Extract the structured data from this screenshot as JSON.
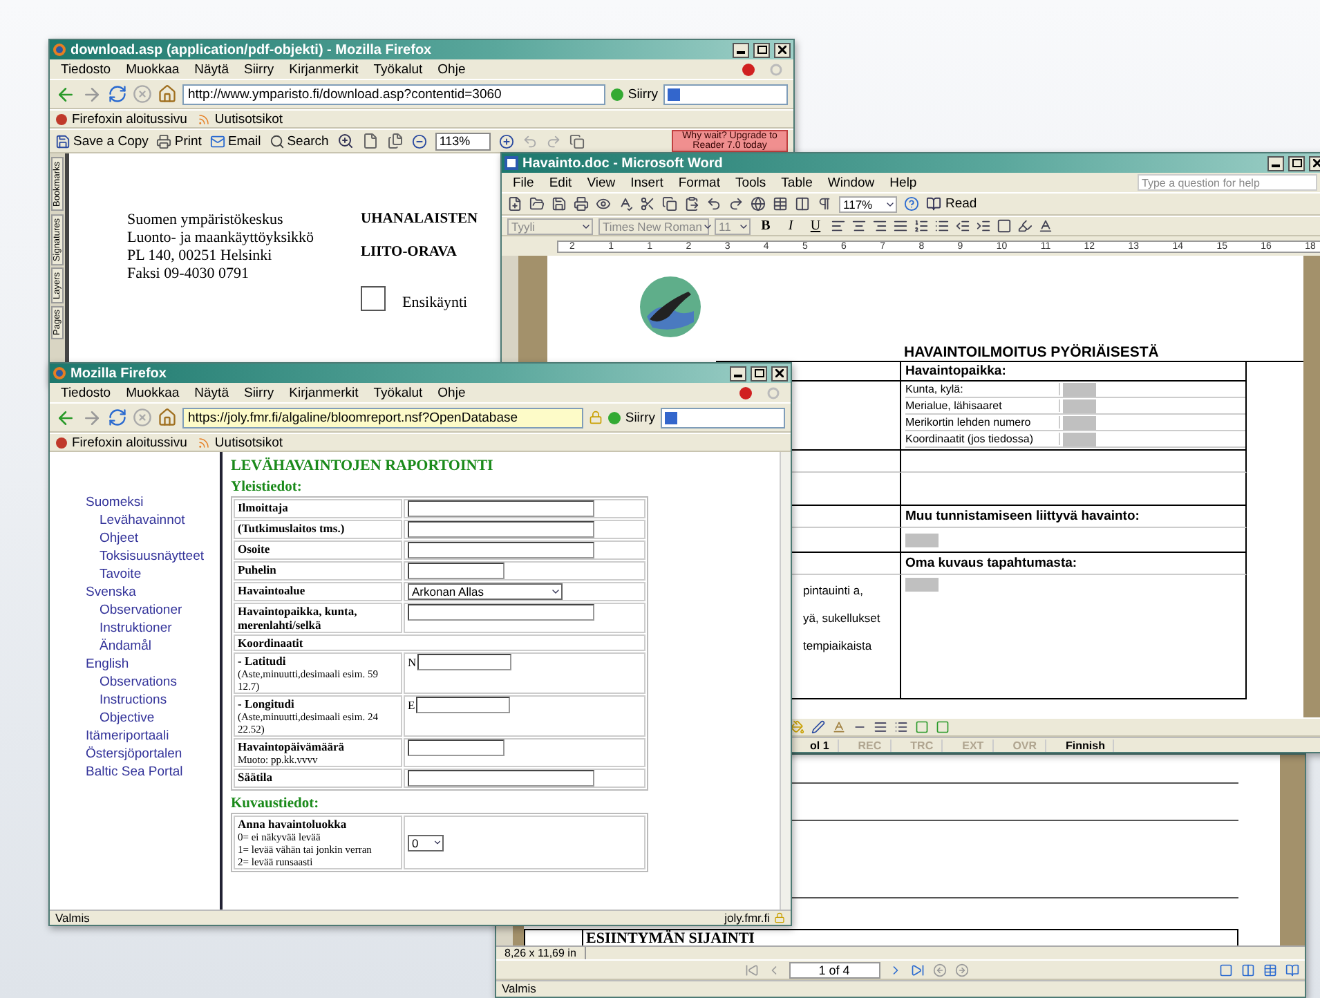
{
  "pdf_window": {
    "title": "download.asp (application/pdf-objekti) - Mozilla Firefox",
    "menu": [
      "Tiedosto",
      "Muokkaa",
      "Näytä",
      "Siirry",
      "Kirjanmerkit",
      "Työkalut",
      "Ohje"
    ],
    "address": "http://www.ymparisto.fi/download.asp?contentid=3060",
    "go": "Siirry",
    "bookmarks": [
      "Firefoxin aloitussivu",
      "Uutisotsikot"
    ],
    "pdf_toolbar": [
      {
        "kind": "save",
        "label": "Save a Copy"
      },
      {
        "kind": "print",
        "label": "Print"
      },
      {
        "kind": "email",
        "label": "Email"
      },
      {
        "kind": "search",
        "label": "Search"
      }
    ],
    "zoom": "113%",
    "upgrade": "Why wait? Upgrade to Reader 7.0 today",
    "side_tabs": [
      "Bookmarks",
      "Signatures",
      "Layers",
      "Pages"
    ],
    "sender_lines": [
      "Suomen ympäristökeskus",
      "Luonto- ja maankäyttöyksikkö",
      "PL 140, 00251 Helsinki",
      "Faksi 09-4030 0791"
    ],
    "heading": "UHANALAISTEN",
    "subheading": "LIITO-ORAVA",
    "checkbox": {
      "label": "Ensikäynti",
      "checked": false
    }
  },
  "reader_window": {
    "heading": "ESIINTYMÄN SIJAINTI",
    "page_size": "8,26 x 11,69 in",
    "page": "1 of 4",
    "status": "Valmis"
  },
  "word_window": {
    "title": "Havainto.doc - Microsoft Word",
    "menu": [
      "File",
      "Edit",
      "View",
      "Insert",
      "Format",
      "Tools",
      "Table",
      "Window",
      "Help"
    ],
    "help_placeholder": "Type a question for help",
    "zoom": "117%",
    "read": "Read",
    "style": "Tyyli",
    "font": "Times New Roman",
    "size": "11",
    "format_buttons": [
      "B",
      "I",
      "U"
    ],
    "ruler": [
      "2",
      "1",
      "1",
      "2",
      "3",
      "4",
      "5",
      "6",
      "7",
      "8",
      "9",
      "10",
      "11",
      "12",
      "13",
      "14",
      "15",
      "16",
      "18"
    ],
    "doc_title": "HAVAINTOILMOITUS PYÖRIÄISESTÄ",
    "place_heading": "Havaintopaikka:",
    "place_fields": [
      "Kunta, kylä:",
      "Merialue, lähisaaret",
      "Merikortin lehden numero",
      "Koordinaatit (jos tiedossa)"
    ],
    "other_heading": "Muu tunnistamiseen liittyvä havainto:",
    "own_heading": "Oma kuvaus tapahtumasta:",
    "left_fragments": [
      "pintauinti a,",
      "yä, sukellukset",
      "tempiaikaista"
    ],
    "status": [
      {
        "label": "ol 1",
        "disabled": false
      },
      {
        "label": "REC",
        "disabled": true
      },
      {
        "label": "TRC",
        "disabled": true
      },
      {
        "label": "EXT",
        "disabled": true
      },
      {
        "label": "OVR",
        "disabled": true
      },
      {
        "label": "Finnish",
        "disabled": false
      }
    ]
  },
  "form_window": {
    "title": "Mozilla Firefox",
    "menu": [
      "Tiedosto",
      "Muokkaa",
      "Näytä",
      "Siirry",
      "Kirjanmerkit",
      "Työkalut",
      "Ohje"
    ],
    "address": "https://joly.fmr.fi/algaline/bloomreport.nsf?OpenDatabase",
    "go": "Siirry",
    "bookmarks": [
      "Firefoxin aloitussivu",
      "Uutisotsikot"
    ],
    "nav": [
      {
        "label": "Suomeksi",
        "children": [
          {
            "label": "Levähavainnot"
          },
          {
            "label": "Ohjeet"
          },
          {
            "label": "Toksisuusnäytteet"
          },
          {
            "label": "Tavoite"
          }
        ]
      },
      {
        "label": "Svenska",
        "children": [
          {
            "label": "Observationer"
          },
          {
            "label": "Instruktioner"
          },
          {
            "label": "Ändamål"
          }
        ]
      },
      {
        "label": "English",
        "children": [
          {
            "label": "Observations"
          },
          {
            "label": "Instructions"
          },
          {
            "label": "Objective"
          }
        ]
      },
      {
        "label": "Itämeriportaali"
      },
      {
        "label": "Östersjöportalen"
      },
      {
        "label": "Baltic Sea Portal"
      }
    ],
    "form_title": "LEVÄHAVAINTOJEN RAPORTOINTI",
    "general_heading": "Yleistiedot:",
    "rows": [
      {
        "kind": "long",
        "label": "Ilmoittaja"
      },
      {
        "kind": "long",
        "label": "(Tutkimuslaitos tms.)"
      },
      {
        "kind": "long",
        "label": "Osoite"
      },
      {
        "kind": "short",
        "label": "Puhelin"
      },
      {
        "kind": "select",
        "label": "Havaintoalue",
        "value": "Arkonan Allas"
      },
      {
        "kind": "long",
        "label": "Havaintopaikka, kunta, merenlahti/selkä"
      },
      {
        "kind": "header",
        "label": "Koordinaatit"
      },
      {
        "kind": "coord",
        "label": "- Latitudi",
        "notes": [
          "(Aste,minuutti,desimaali esim. 59 12.7)"
        ],
        "prefix": "N"
      },
      {
        "kind": "coord",
        "label": "- Longitudi",
        "notes": [
          "(Aste,minuutti,desimaali esim. 24 22.52)"
        ],
        "prefix": "E"
      },
      {
        "kind": "short",
        "label": "Havaintopäivämäärä",
        "notes": [
          "Muoto: pp.kk.vvvv"
        ]
      },
      {
        "kind": "long",
        "label": "Säätila"
      }
    ],
    "description_heading": "Kuvaustiedot:",
    "class_row": {
      "label": "Anna havaintoluokka",
      "notes": [
        "0= ei näkyvää levää",
        "1= levää vähän tai jonkin verran",
        "2= levää runsaasti"
      ],
      "value": "0"
    },
    "status": "Valmis",
    "status_host": "joly.fmr.fi"
  }
}
